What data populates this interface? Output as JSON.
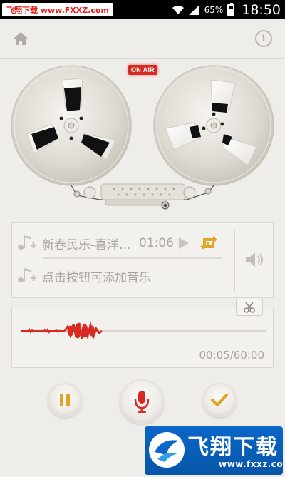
{
  "status_bar": {
    "watermark": "飞翔下载 www.FXXZ.com",
    "battery": "65%",
    "time": "18:50"
  },
  "toolbar": {
    "home_icon": "home-icon",
    "info_icon": "info-icon",
    "info_glyph": "i"
  },
  "recorder": {
    "on_air_label": "ON AIR",
    "accent_color": "#d72a22"
  },
  "music": {
    "tracks": [
      {
        "title": "新春民乐-喜洋...",
        "time": "01:06"
      },
      {
        "title": "点击按钮可添加音乐"
      }
    ]
  },
  "waveform": {
    "time_display": "00:05/60:00"
  },
  "watermark_bottom": {
    "text": "飞翔下载",
    "url": "www.fxxz.com"
  }
}
